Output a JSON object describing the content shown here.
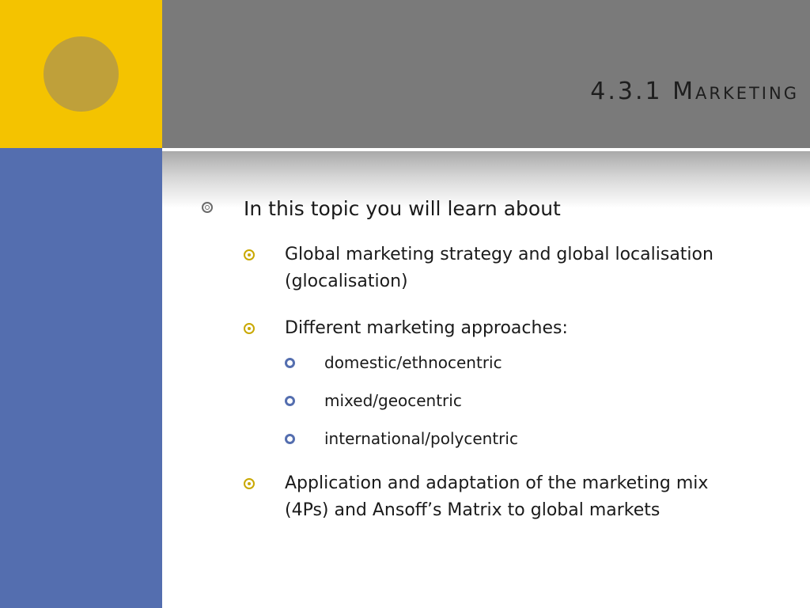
{
  "slide": {
    "title": "4.3.1 Marketing",
    "colors": {
      "accent_yellow": "#f4c300",
      "accent_blue": "#546eaf",
      "title_band": "#7a7a7a",
      "circle": "#bfa03a"
    }
  },
  "content": {
    "intro": "In this topic you will learn about",
    "item1": "Global marketing strategy and global localisation (glocalisation)",
    "item2": "Different marketing approaches:",
    "approaches": [
      "domestic/ethnocentric",
      "mixed/geocentric",
      "international/polycentric"
    ],
    "item3": "Application and adaptation of the marketing mix (4Ps) and Ansoff’s Matrix to global markets"
  },
  "icons": {
    "level1": "target-bullet-icon",
    "level2": "dot-circle-bullet-icon",
    "level3": "ring-bullet-icon"
  }
}
